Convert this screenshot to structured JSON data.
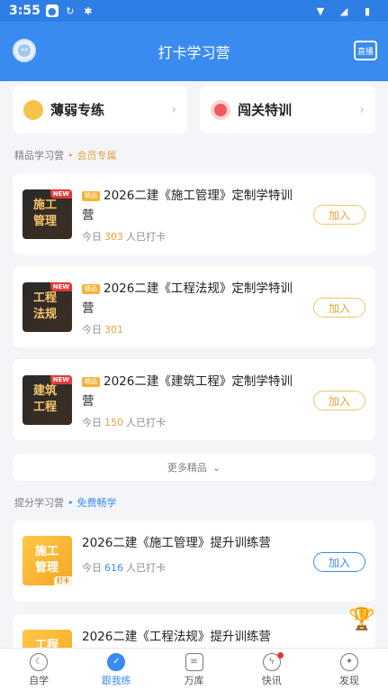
{
  "status": {
    "time": "3:55"
  },
  "header": {
    "title": "打卡学习营",
    "live_label": "直播"
  },
  "quick": [
    {
      "label": "薄弱专练",
      "icon": "chat-bubble-icon"
    },
    {
      "label": "闯关特训",
      "icon": "target-icon"
    }
  ],
  "premium_section": {
    "title": "精品学习营",
    "badge": "会员专属"
  },
  "premium_cards": [
    {
      "cover_line1": "施工",
      "cover_line2": "管理",
      "new": "NEW",
      "tag": "精品",
      "name": "2026二建《施工管理》定制学特训营",
      "today_prefix": "今日",
      "count": "303",
      "today_suffix": "人已打卡",
      "join": "加入"
    },
    {
      "cover_line1": "工程",
      "cover_line2": "法规",
      "new": "NEW",
      "tag": "精品",
      "name": "2026二建《工程法规》定制学特训营",
      "today_prefix": "今日",
      "count": "301",
      "today_suffix": "",
      "join": "加入"
    },
    {
      "cover_line1": "建筑",
      "cover_line2": "工程",
      "new": "NEW",
      "tag": "精品",
      "name": "2026二建《建筑工程》定制学特训营",
      "today_prefix": "今日",
      "count": "150",
      "today_suffix": "人已打卡",
      "join": "加入"
    }
  ],
  "more": {
    "label": "更多精品"
  },
  "boost_section": {
    "title": "提分学习营",
    "badge": "免费畅学"
  },
  "boost_cards": [
    {
      "cover_line1": "施工",
      "cover_line2": "管理",
      "daka": "打卡",
      "name": "2026二建《施工管理》提升训练营",
      "today_prefix": "今日",
      "count": "616",
      "today_suffix": "人已打卡",
      "join": "加入"
    },
    {
      "cover_line1": "工程",
      "cover_line2": "",
      "name": "2026二建《工程法规》提升训练营"
    }
  ],
  "tabs": [
    {
      "label": "自学",
      "icon": "moon-icon"
    },
    {
      "label": "跟我练",
      "icon": "check-icon"
    },
    {
      "label": "万库",
      "icon": "document-icon"
    },
    {
      "label": "快讯",
      "icon": "lightning-icon"
    },
    {
      "label": "发现",
      "icon": "compass-icon"
    }
  ]
}
